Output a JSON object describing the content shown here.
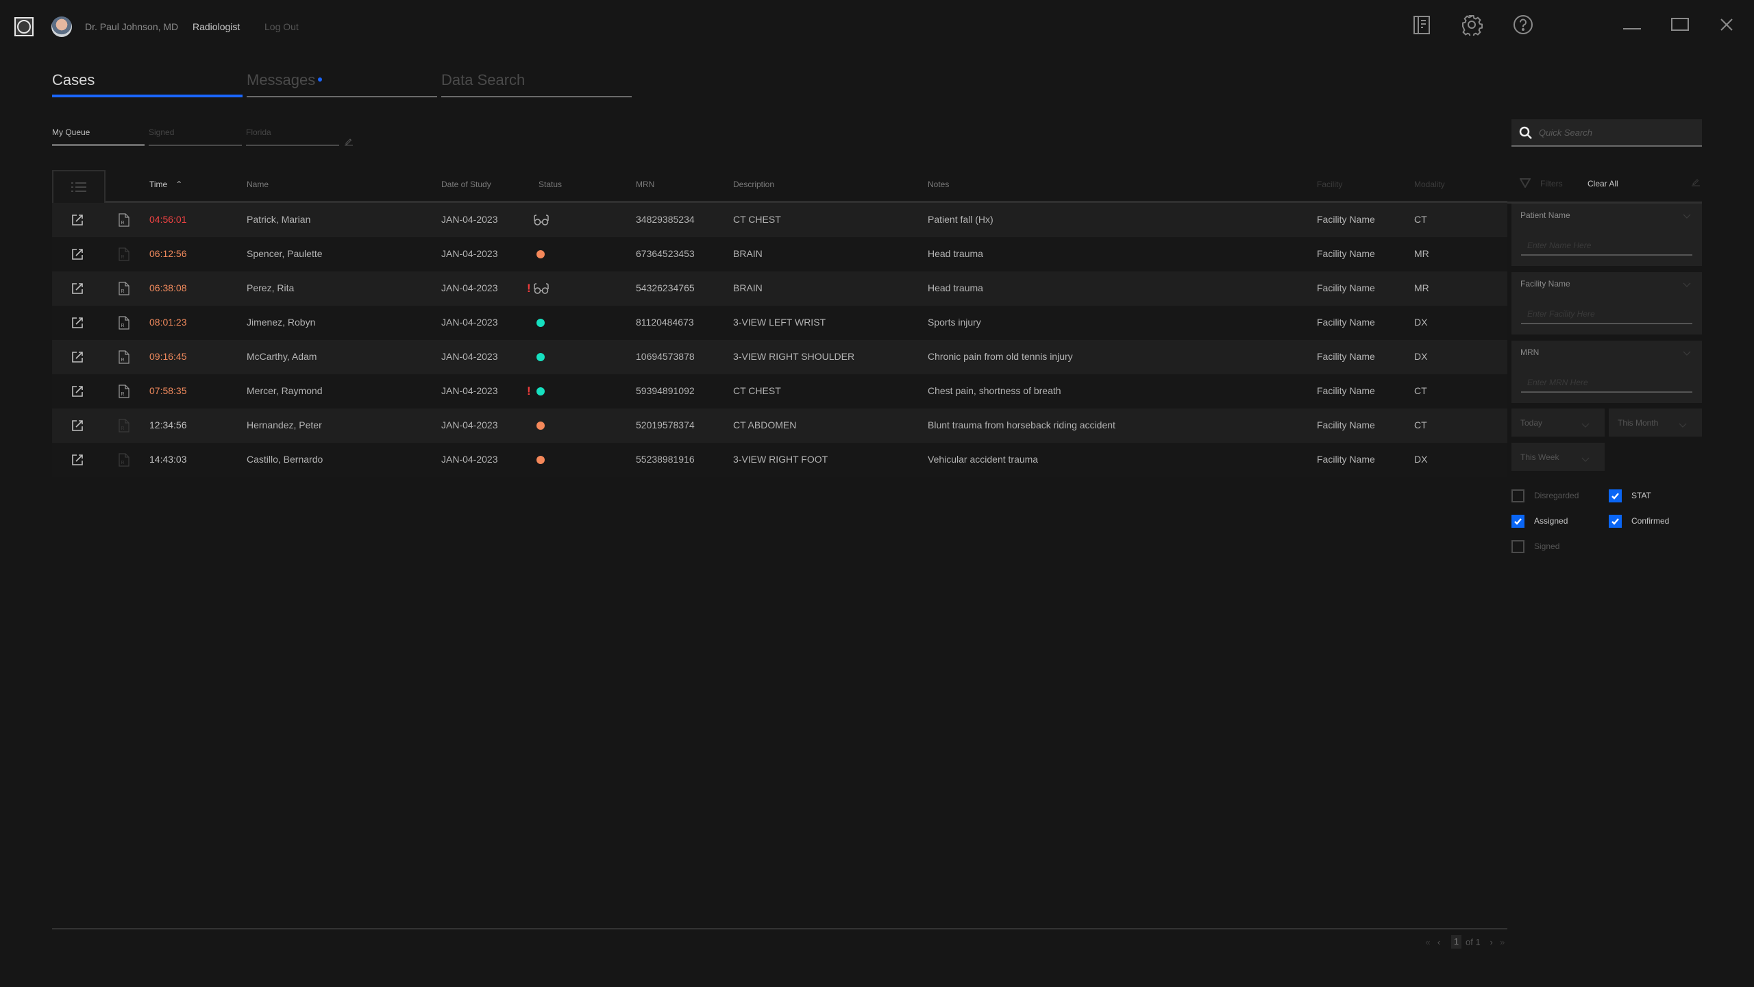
{
  "app": {
    "user_name": "Dr. Paul Johnson, MD",
    "user_role": "Radiologist",
    "logout_label": "Log Out",
    "icons": [
      "logo-icon",
      "user-avatar",
      "worklist-icon",
      "settings-gear-icon",
      "help-icon",
      "minimize-icon",
      "maximize-icon",
      "close-icon"
    ]
  },
  "tabs": [
    {
      "label": "Cases",
      "active": true
    },
    {
      "label": "Messages",
      "active": false,
      "has_notification": true
    },
    {
      "label": "Data Search",
      "active": false
    }
  ],
  "subtabs": [
    {
      "label": "My Queue",
      "active": true
    },
    {
      "label": "Signed",
      "active": false
    },
    {
      "label": "Florida",
      "active": false,
      "editable": true
    }
  ],
  "table": {
    "columns": {
      "time": "Time",
      "name": "Name",
      "date": "Date of Study",
      "status": "Status",
      "mrn": "MRN",
      "description": "Description",
      "notes": "Notes",
      "facility": "Facility",
      "modality": "Modality"
    },
    "sort": {
      "column": "Time",
      "direction": "ascending"
    },
    "rows": [
      {
        "time": "04:56:01",
        "time_color": "red",
        "report": "active",
        "name": "Patrick, Marian",
        "date": "JAN-04-2023",
        "stat": false,
        "status": "preliminary-read",
        "mrn": "34829385234",
        "description": "CT CHEST",
        "notes": "Patient fall (Hx)",
        "facility": "Facility Name",
        "modality": "CT"
      },
      {
        "time": "06:12:56",
        "time_color": "orange",
        "report": "inactive",
        "name": "Spencer, Paulette",
        "date": "JAN-04-2023",
        "stat": false,
        "status": "orange",
        "mrn": "67364523453",
        "description": "BRAIN",
        "notes": "Head trauma",
        "facility": "Facility Name",
        "modality": "MR"
      },
      {
        "time": "06:38:08",
        "time_color": "orange",
        "report": "active",
        "name": "Perez, Rita",
        "date": "JAN-04-2023",
        "stat": true,
        "status": "preliminary-read",
        "mrn": "54326234765",
        "description": "BRAIN",
        "notes": "Head trauma",
        "facility": "Facility Name",
        "modality": "MR"
      },
      {
        "time": "08:01:23",
        "time_color": "orange",
        "report": "active",
        "name": "Jimenez, Robyn",
        "date": "JAN-04-2023",
        "stat": false,
        "status": "teal",
        "mrn": "81120484673",
        "description": "3-VIEW LEFT WRIST",
        "notes": "Sports injury",
        "facility": "Facility Name",
        "modality": "DX"
      },
      {
        "time": "09:16:45",
        "time_color": "orange",
        "report": "active",
        "name": "McCarthy, Adam",
        "date": "JAN-04-2023",
        "stat": false,
        "status": "teal",
        "mrn": "10694573878",
        "description": "3-VIEW RIGHT SHOULDER",
        "notes": "Chronic pain from old tennis injury",
        "facility": "Facility Name",
        "modality": "DX"
      },
      {
        "time": "07:58:35",
        "time_color": "orange",
        "report": "active",
        "name": "Mercer, Raymond",
        "date": "JAN-04-2023",
        "stat": true,
        "status": "teal",
        "mrn": "59394891092",
        "description": "CT CHEST",
        "notes": "Chest pain, shortness of breath",
        "facility": "Facility Name",
        "modality": "CT"
      },
      {
        "time": "12:34:56",
        "time_color": "plain",
        "report": "inactive",
        "name": "Hernandez, Peter",
        "date": "JAN-04-2023",
        "stat": false,
        "status": "orange",
        "mrn": "52019578374",
        "description": "CT ABDOMEN",
        "notes": "Blunt trauma from horseback riding accident",
        "facility": "Facility Name",
        "modality": "CT"
      },
      {
        "time": "14:43:03",
        "time_color": "plain",
        "report": "inactive",
        "name": "Castillo, Bernardo",
        "date": "JAN-04-2023",
        "stat": false,
        "status": "orange",
        "mrn": "55238981916",
        "description": "3-VIEW RIGHT FOOT",
        "notes": "Vehicular accident trauma",
        "facility": "Facility Name",
        "modality": "DX"
      }
    ]
  },
  "pagination": {
    "current": "1",
    "of_label": "of 1"
  },
  "search": {
    "placeholder": "Quick Search",
    "value": ""
  },
  "filters": {
    "label": "Filters",
    "clear_all": "Clear All",
    "groups": [
      {
        "title": "Patient Name",
        "placeholder": "Enter Name Here"
      },
      {
        "title": "Facility Name",
        "placeholder": "Enter Facility Here"
      },
      {
        "title": "MRN",
        "placeholder": "Enter MRN Here"
      }
    ],
    "dropdowns": [
      {
        "value": "Today"
      },
      {
        "value": "This Month"
      },
      {
        "value": "This Week"
      }
    ],
    "checkboxes": [
      {
        "label": "Disregarded",
        "checked": false
      },
      {
        "label": "STAT",
        "checked": true
      },
      {
        "label": "Assigned",
        "checked": true
      },
      {
        "label": "Confirmed",
        "checked": true
      },
      {
        "label": "Signed",
        "checked": false
      }
    ]
  },
  "colors": {
    "accent": "#1a66ff",
    "time_red": "#f24343",
    "time_orange": "#f08a5d",
    "status_orange": "#f5885a",
    "status_teal": "#16e0c0",
    "stat_flag": "#f23c3c",
    "background": "#161616"
  }
}
